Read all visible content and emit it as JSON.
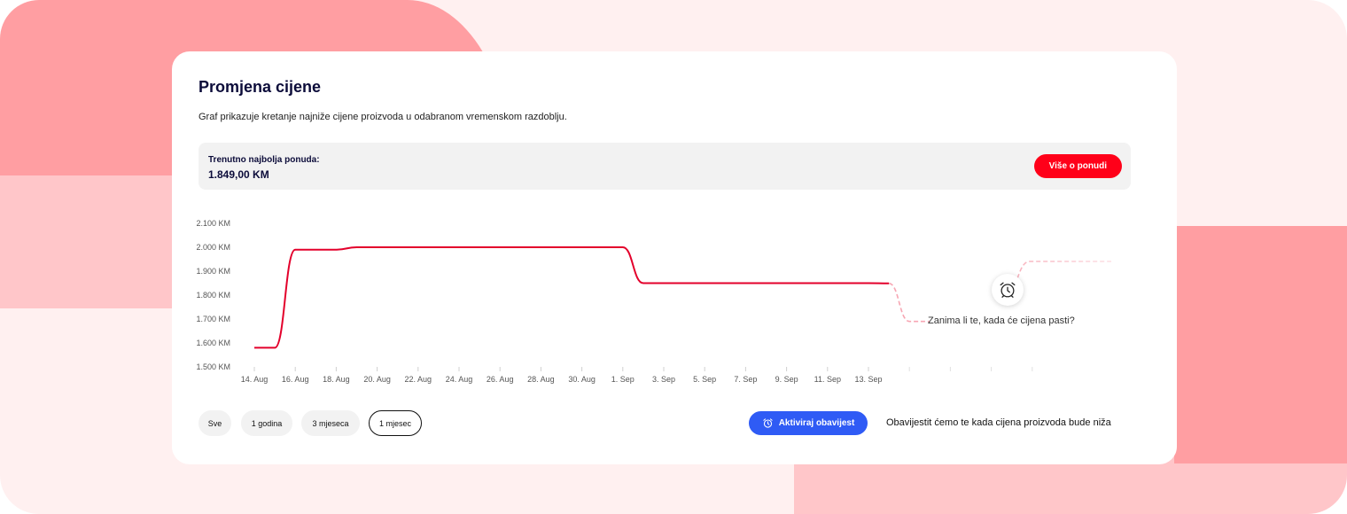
{
  "card": {
    "title": "Promjena cijene",
    "subtitle": "Graf prikazuje kretanje najniže cijene proizvoda u odabranom vremenskom razdoblju."
  },
  "offer": {
    "label": "Trenutno najbolja ponuda:",
    "price": "1.849,00 KM",
    "button": "Više o ponudi"
  },
  "chart_data": {
    "type": "line",
    "title": "",
    "xlabel": "",
    "ylabel": "",
    "ylim": [
      1500,
      2100
    ],
    "yticks": [
      2100,
      2000,
      1900,
      1800,
      1700,
      1600,
      1500
    ],
    "ytick_labels": [
      "2.100 KM",
      "2.000 KM",
      "1.900 KM",
      "1.800 KM",
      "1.700 KM",
      "1.600 KM",
      "1.500 KM"
    ],
    "xtick_labels": [
      "14. Aug",
      "16. Aug",
      "18. Aug",
      "20. Aug",
      "22. Aug",
      "24. Aug",
      "26. Aug",
      "28. Aug",
      "30. Aug",
      "1. Sep",
      "3. Sep",
      "5. Sep",
      "7. Sep",
      "9. Sep",
      "11. Sep",
      "13. Sep"
    ],
    "grid": true,
    "series": [
      {
        "color": "#e3002b",
        "points": [
          {
            "x": "14. Aug",
            "y": 1580
          },
          {
            "x": "15. Aug",
            "y": 1580
          },
          {
            "x": "16. Aug",
            "y": 1990
          },
          {
            "x": "18. Aug",
            "y": 1990
          },
          {
            "x": "19. Aug",
            "y": 2000
          },
          {
            "x": "31. Aug",
            "y": 2000
          },
          {
            "x": "1. Sep",
            "y": 2000
          },
          {
            "x": "2. Sep",
            "y": 1850
          },
          {
            "x": "13. Sep",
            "y": 1850
          },
          {
            "x": "14. Sep",
            "y": 1849
          }
        ]
      }
    ],
    "projection": {
      "color": "#f7a6b3",
      "style": "dashed",
      "points": [
        {
          "x": "14. Sep",
          "y": 1849
        },
        {
          "x": "15. Sep",
          "y": 1690
        },
        {
          "x": "16. Sep",
          "y": 1690
        }
      ]
    }
  },
  "overlay": {
    "icon": "alarm-clock-icon",
    "question": "Zanima li te, kada će cijena pasti?"
  },
  "ranges": {
    "items": [
      "Sve",
      "1 godina",
      "3 mjeseca",
      "1 mjesec"
    ],
    "active": "1 mjesec"
  },
  "notify": {
    "button": "Aktiviraj obavijest",
    "text": "Obavijestit ćemo te kada cijena proizvoda bude niža"
  },
  "colors": {
    "accent_red": "#ff0019",
    "line_red": "#e3002b",
    "accent_blue": "#2f5bf5",
    "title_navy": "#0c0c3a"
  }
}
